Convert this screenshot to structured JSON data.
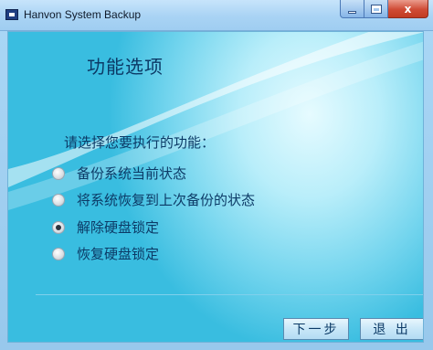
{
  "window": {
    "title": "Hanvon System Backup",
    "controls": {
      "minimize": "minimize",
      "maximize": "maximize",
      "close": "x"
    }
  },
  "page": {
    "heading": "功能选项",
    "prompt": "请选择您要执行的功能：",
    "options": [
      {
        "label": "备份系统当前状态",
        "checked": false
      },
      {
        "label": "将系统恢复到上次备份的状态",
        "checked": false
      },
      {
        "label": "解除硬盘锁定",
        "checked": true
      },
      {
        "label": "恢复硬盘锁定",
        "checked": false
      }
    ]
  },
  "buttons": {
    "next": "下一步",
    "exit": "退 出"
  },
  "colors": {
    "text": "#0c3a66",
    "accent": "#39bde0",
    "close": "#c13b23"
  }
}
